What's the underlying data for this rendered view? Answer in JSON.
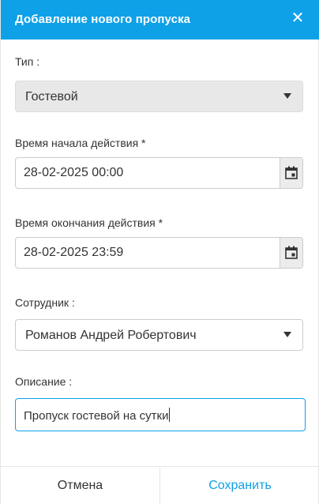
{
  "dialog": {
    "title": "Добавление нового пропуска",
    "close_symbol": "✕"
  },
  "fields": {
    "type": {
      "label": "Тип :",
      "value": "Гостевой"
    },
    "start_time": {
      "label": "Время начала действия *",
      "value": "28-02-2025 00:00"
    },
    "end_time": {
      "label": "Время окончания действия *",
      "value": "28-02-2025 23:59"
    },
    "employee": {
      "label": "Сотрудник :",
      "value": "Романов Андрей Робертович"
    },
    "description": {
      "label": "Описание :",
      "value": "Пропуск гостевой на сутки"
    }
  },
  "footer": {
    "cancel_label": "Отмена",
    "save_label": "Сохранить"
  },
  "colors": {
    "accent": "#0ea1e7",
    "disabled_bg": "#e8e8e8"
  },
  "icons": [
    "close-icon",
    "chevron-down-icon",
    "calendar-icon"
  ]
}
